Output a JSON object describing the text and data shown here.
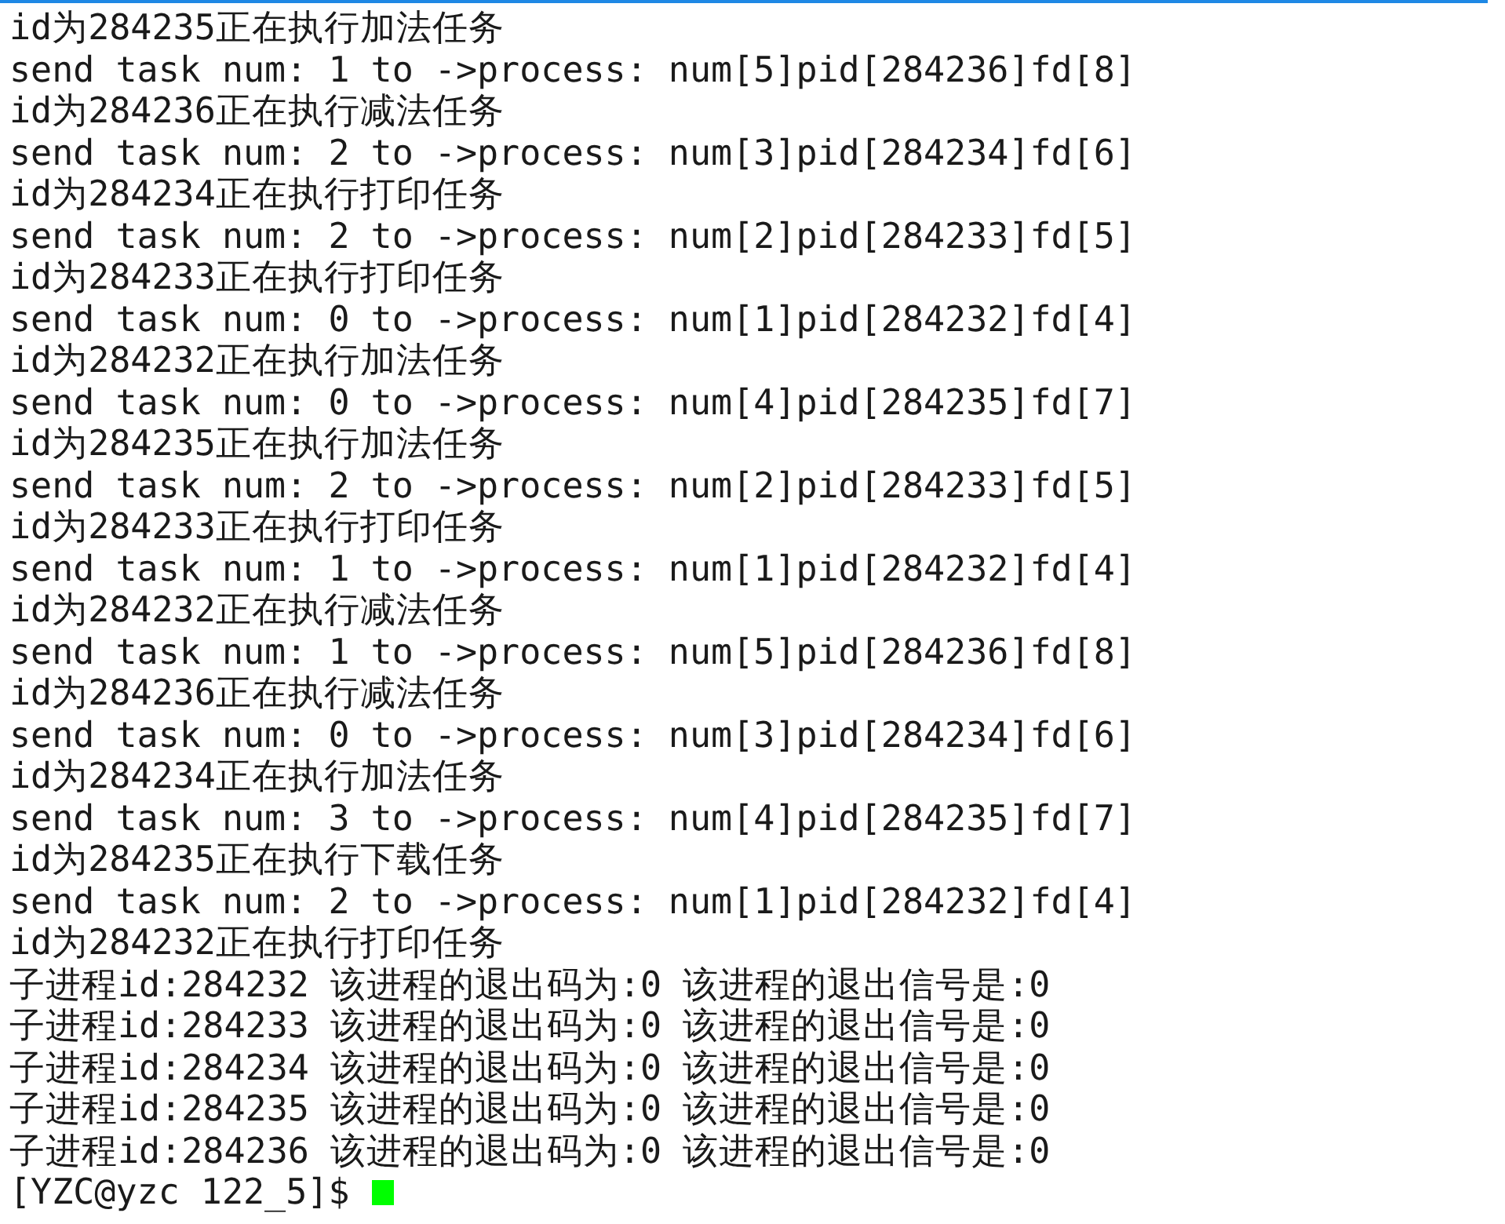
{
  "terminal": {
    "lines": [
      "id为284235正在执行加法任务",
      "send task num: 1 to ->process: num[5]pid[284236]fd[8]",
      "id为284236正在执行减法任务",
      "send task num: 2 to ->process: num[3]pid[284234]fd[6]",
      "id为284234正在执行打印任务",
      "send task num: 2 to ->process: num[2]pid[284233]fd[5]",
      "id为284233正在执行打印任务",
      "send task num: 0 to ->process: num[1]pid[284232]fd[4]",
      "id为284232正在执行加法任务",
      "send task num: 0 to ->process: num[4]pid[284235]fd[7]",
      "id为284235正在执行加法任务",
      "send task num: 2 to ->process: num[2]pid[284233]fd[5]",
      "id为284233正在执行打印任务",
      "send task num: 1 to ->process: num[1]pid[284232]fd[4]",
      "id为284232正在执行减法任务",
      "send task num: 1 to ->process: num[5]pid[284236]fd[8]",
      "id为284236正在执行减法任务",
      "send task num: 0 to ->process: num[3]pid[284234]fd[6]",
      "id为284234正在执行加法任务",
      "send task num: 3 to ->process: num[4]pid[284235]fd[7]",
      "id为284235正在执行下载任务",
      "send task num: 2 to ->process: num[1]pid[284232]fd[4]",
      "id为284232正在执行打印任务",
      "子进程id:284232 该进程的退出码为:0 该进程的退出信号是:0",
      "子进程id:284233 该进程的退出码为:0 该进程的退出信号是:0",
      "子进程id:284234 该进程的退出码为:0 该进程的退出信号是:0",
      "子进程id:284235 该进程的退出码为:0 该进程的退出信号是:0",
      "子进程id:284236 该进程的退出码为:0 该进程的退出信号是:0"
    ],
    "prompt": "[YZC@yzc 122_5]$",
    "cursor": true
  }
}
